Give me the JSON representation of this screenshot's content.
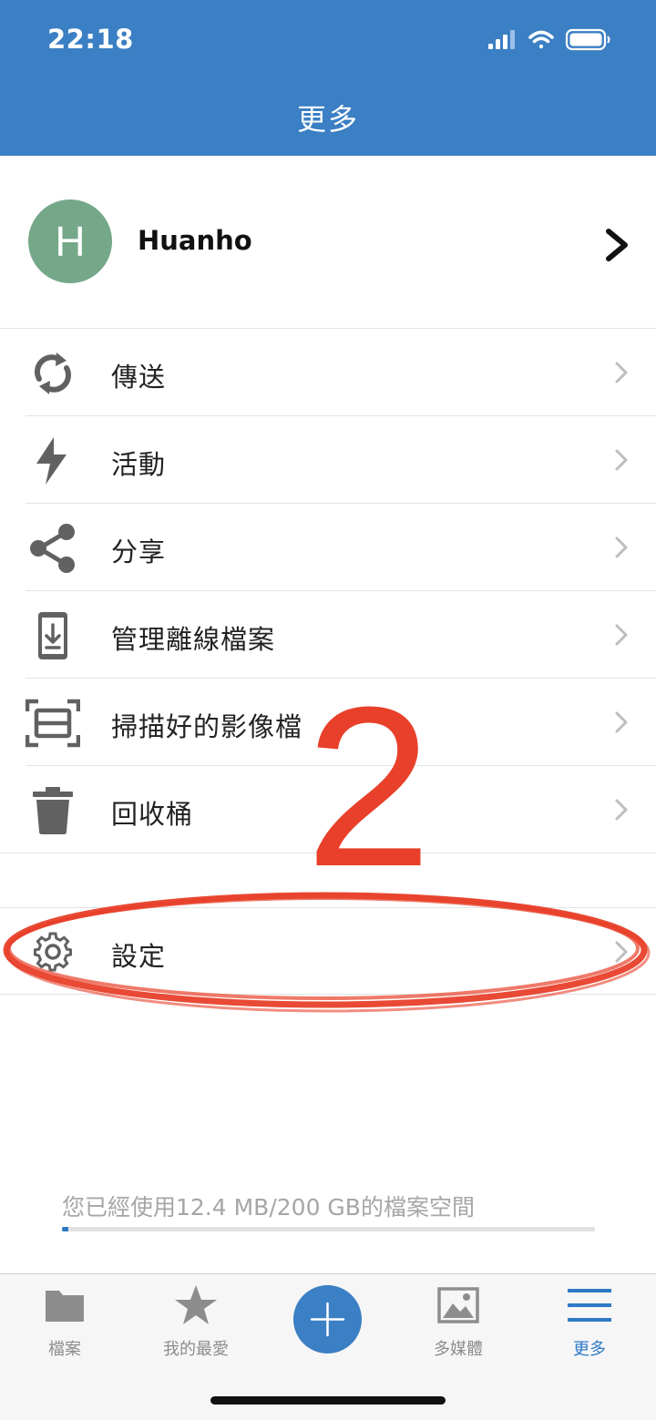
{
  "status_bar": {
    "time": "22:18"
  },
  "header": {
    "title": "更多"
  },
  "profile": {
    "initial": "H",
    "name": "Huanho"
  },
  "menu_items": [
    {
      "label": "傳送",
      "icon": "sync-icon"
    },
    {
      "label": "活動",
      "icon": "lightning-icon"
    },
    {
      "label": "分享",
      "icon": "share-icon"
    },
    {
      "label": "管理離線檔案",
      "icon": "phone-download-icon"
    },
    {
      "label": "掃描好的影像檔",
      "icon": "scan-icon"
    },
    {
      "label": "回收桶",
      "icon": "trash-icon"
    }
  ],
  "settings": {
    "label": "設定",
    "icon": "gear-icon"
  },
  "storage": {
    "text": "您已經使用12.4 MB/200 GB的檔案空間",
    "used_fraction": 0.012
  },
  "tabs": [
    {
      "label": "檔案",
      "icon": "folder-icon",
      "active": false
    },
    {
      "label": "我的最愛",
      "icon": "star-icon",
      "active": false
    },
    {
      "label": "",
      "icon": "plus-icon",
      "active": false
    },
    {
      "label": "多媒體",
      "icon": "image-icon",
      "active": false
    },
    {
      "label": "更多",
      "icon": "menu-icon",
      "active": true
    }
  ],
  "annotation": {
    "number": "2",
    "color": "#e8402a"
  },
  "colors": {
    "brand": "#3b7fc4",
    "active_tab": "#2f7ac6",
    "avatar": "#74a889"
  }
}
